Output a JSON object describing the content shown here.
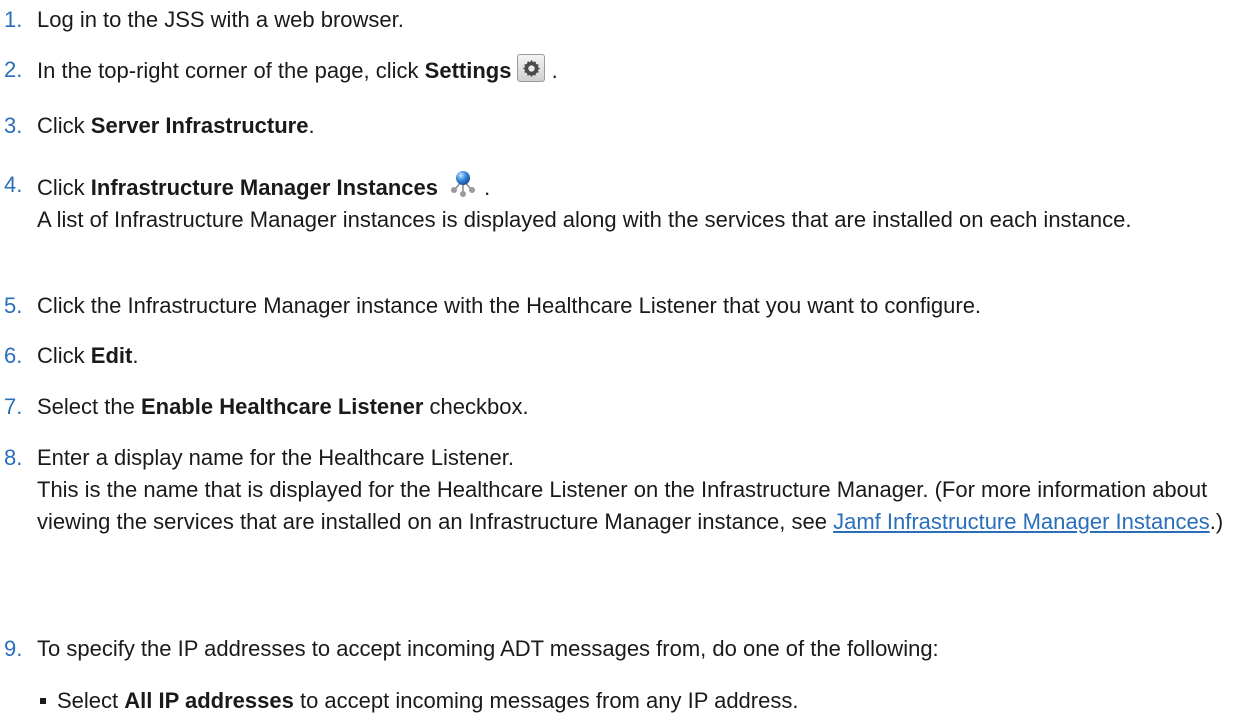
{
  "steps": [
    {
      "num": "1.",
      "text": "Log in to the JSS with a web browser."
    },
    {
      "num": "2.",
      "pre": "In the top-right corner of the page, click ",
      "bold": "Settings",
      "post": " .",
      "icon": "gear-icon"
    },
    {
      "num": "3.",
      "pre": "Click ",
      "bold": "Server Infrastructure",
      "post": "."
    },
    {
      "num": "4.",
      "pre": "Click ",
      "bold": "Infrastructure Manager Instances",
      "post": " .",
      "icon": "network-nodes-icon",
      "detail": "A list of Infrastructure Manager instances is displayed along with the services that are installed on each instance."
    },
    {
      "num": "5.",
      "text": "Click the Infrastructure Manager instance with the Healthcare Listener that you want to configure."
    },
    {
      "num": "6.",
      "pre": "Click ",
      "bold": "Edit",
      "post": "."
    },
    {
      "num": "7.",
      "pre": "Select the ",
      "bold": "Enable Healthcare Listener",
      "post": " checkbox."
    },
    {
      "num": "8.",
      "text": "Enter a display name for the Healthcare Listener.",
      "detail_pre": "This is the name that is displayed for the Healthcare Listener on the Infrastructure Manager. (For more information about viewing the services that are installed on an Infrastructure Manager instance, see ",
      "detail_link": "Jamf Infrastructure Manager Instances",
      "detail_post": ".)"
    },
    {
      "num": "9.",
      "text": "To specify the IP addresses to accept incoming ADT messages from, do one of the following:"
    }
  ],
  "bullets": [
    {
      "pre": "Select ",
      "bold": "All IP addresses",
      "post": " to accept incoming messages from any IP address."
    }
  ],
  "colors": {
    "number": "#2a6ebb",
    "link": "#2a6ebb",
    "text": "#1a1a1a"
  }
}
